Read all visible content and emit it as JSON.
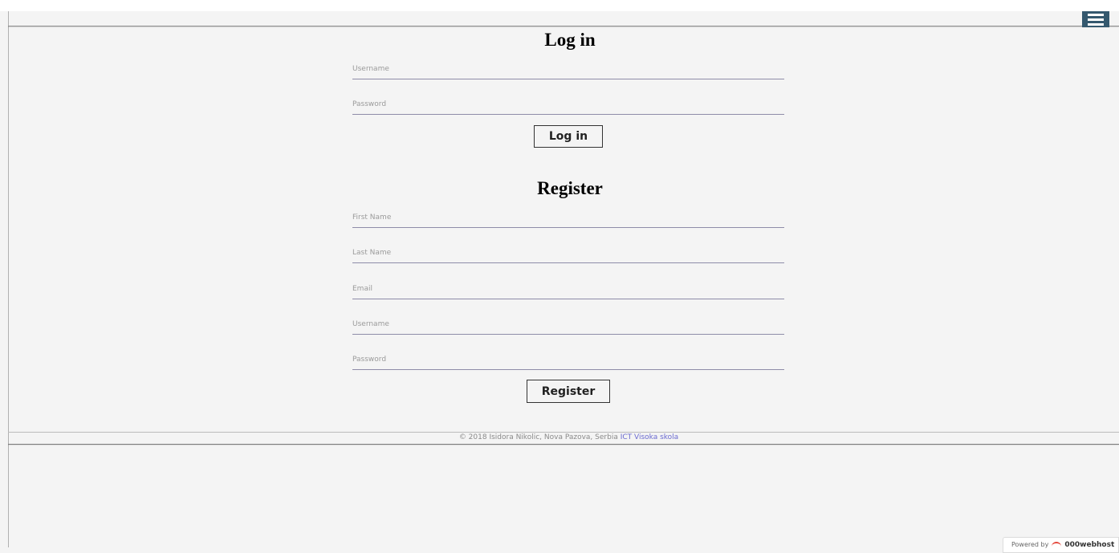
{
  "header": {
    "menu_icon": "hamburger-icon",
    "menu_color": "#34586e"
  },
  "login": {
    "title": "Log in",
    "fields": [
      {
        "placeholder": "Username"
      },
      {
        "placeholder": "Password"
      }
    ],
    "button_label": "Log in"
  },
  "register": {
    "title": "Register",
    "fields": [
      {
        "placeholder": "First Name"
      },
      {
        "placeholder": "Last Name"
      },
      {
        "placeholder": "Email"
      },
      {
        "placeholder": "Username"
      },
      {
        "placeholder": "Password"
      }
    ],
    "button_label": "Register"
  },
  "footer": {
    "copyright": "© 2018 Isidora Nikolic, Nova Pazova, Serbia ",
    "link_text": "ICT Visoka skola",
    "link_color": "#6a6ad0"
  },
  "badge": {
    "prefix": "Powered by",
    "brand": "000webhost",
    "icon": "000webhost-logo-icon"
  }
}
